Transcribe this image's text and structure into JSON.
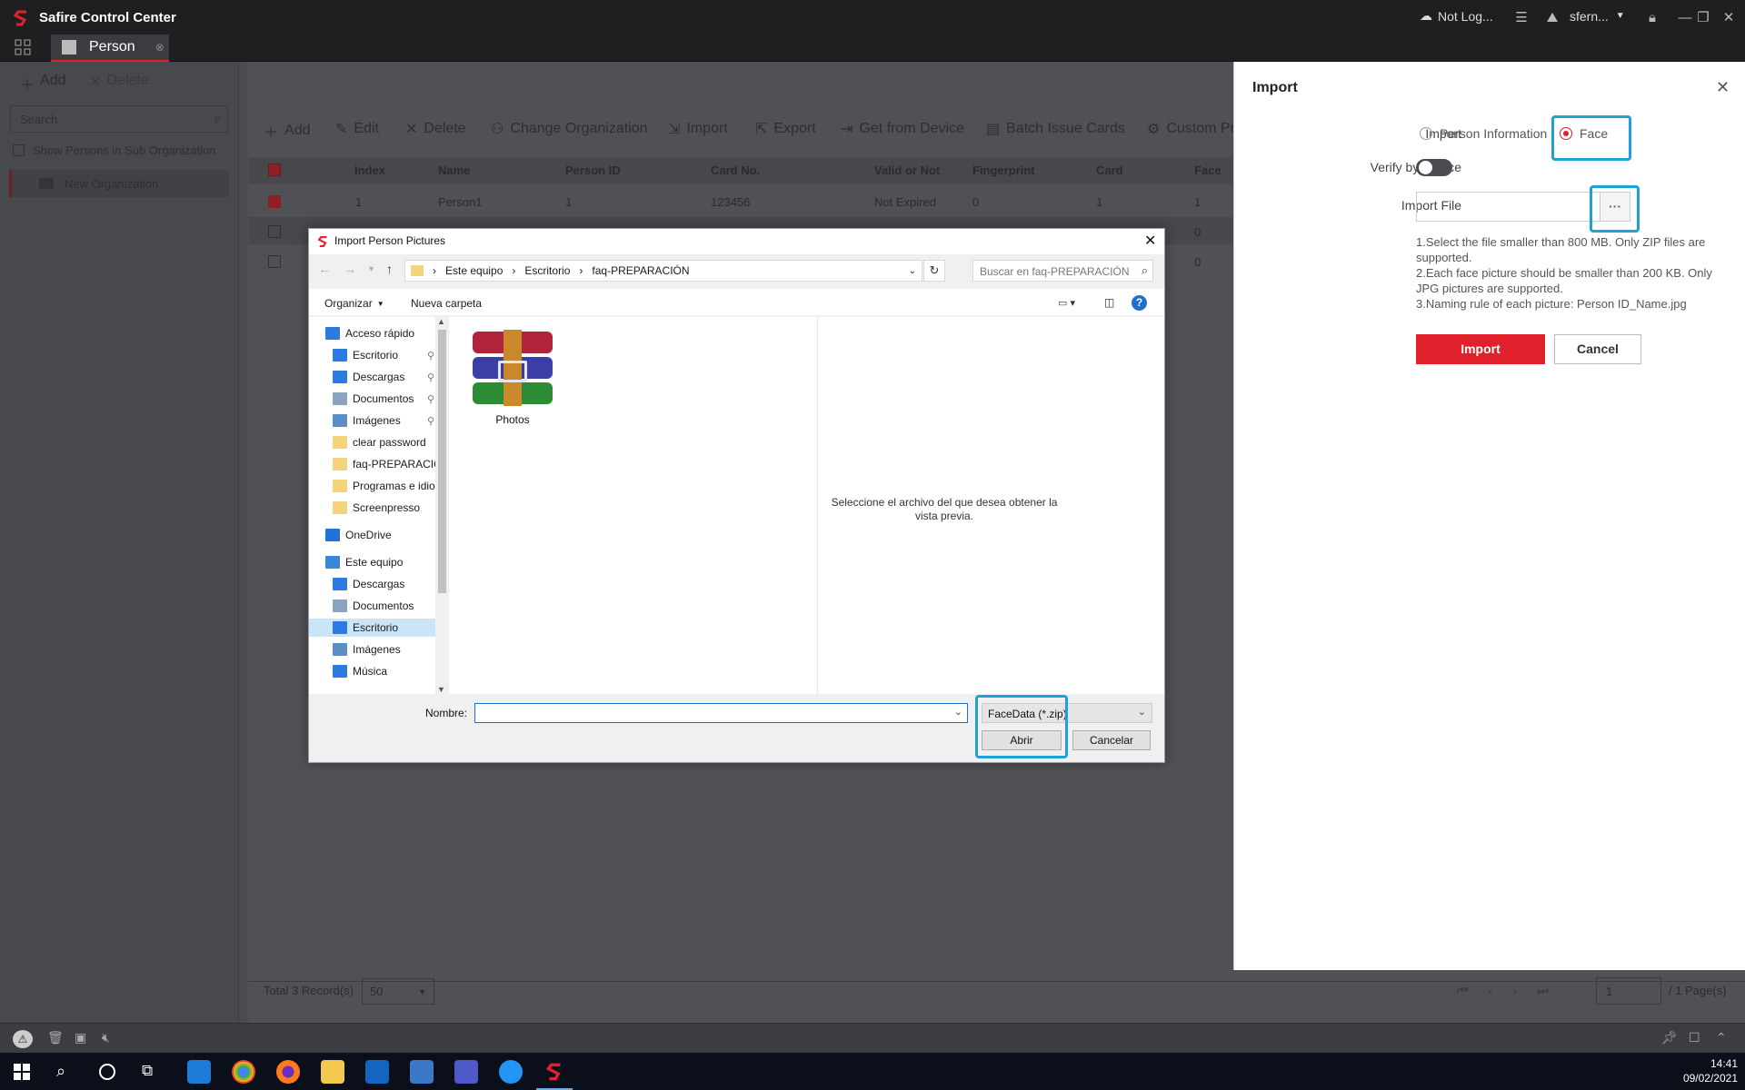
{
  "app": {
    "title": "Safire Control Center",
    "tab": "Person",
    "cloud_status": "Not Log...",
    "user": "sfern..."
  },
  "sidebar": {
    "add": "Add",
    "delete": "Delete",
    "search_placeholder": "Search",
    "show_sub": "Show Persons in Sub Organization",
    "org": "New Organization"
  },
  "toolbar": {
    "add": "Add",
    "edit": "Edit",
    "delete": "Delete",
    "change_org": "Change Organization",
    "import": "Import",
    "export": "Export",
    "get_from_device": "Get from Device",
    "batch_issue": "Batch Issue Cards",
    "custom": "Custom Pr"
  },
  "table": {
    "headers": [
      "Index",
      "Name",
      "Person ID",
      "Card No.",
      "Valid or Not",
      "Fingerprint",
      "Card",
      "Face"
    ],
    "rows": [
      {
        "index": "1",
        "name": "Person1",
        "person_id": "1",
        "card_no": "123456",
        "valid": "Not Expired",
        "fingerprint": "0",
        "card": "1",
        "face": "1"
      },
      {
        "face": "0"
      },
      {
        "face": "0"
      }
    ]
  },
  "footer": {
    "total": "Total 3 Record(s)",
    "page_size": "50",
    "page": "1",
    "pages": "/ 1 Page(s)"
  },
  "import_panel": {
    "title": "Import",
    "import_label": "Import",
    "opt_person": "Person Information",
    "opt_face": "Face",
    "verify_label": "Verify by Device",
    "file_label": "Import File",
    "browse": "···",
    "note1": "1.Select the file smaller than 800 MB. Only ZIP files are supported.",
    "note2": "2.Each face picture should be smaller than 200 KB. Only JPG pictures are supported.",
    "note3": "3.Naming rule of each picture: Person ID_Name.jpg",
    "import_btn": "Import",
    "cancel_btn": "Cancel",
    "accent": "#e0202b",
    "highlight": "#1ea0d9"
  },
  "dialog": {
    "title": "Import Person Pictures",
    "crumbs": [
      "Este equipo",
      "Escritorio",
      "faq-PREPARACIÓN"
    ],
    "search_placeholder": "Buscar en faq-PREPARACIÓN",
    "organize": "Organizar",
    "new_folder": "Nueva carpeta",
    "nav": [
      {
        "label": "Acceso rápido",
        "icon": "star-icon",
        "indent": 0
      },
      {
        "label": "Escritorio",
        "icon": "desktop-icon",
        "indent": 1,
        "pin": true
      },
      {
        "label": "Descargas",
        "icon": "download-icon",
        "indent": 1,
        "pin": true
      },
      {
        "label": "Documentos",
        "icon": "documents-icon",
        "indent": 1,
        "pin": true
      },
      {
        "label": "Imágenes",
        "icon": "images-icon",
        "indent": 1,
        "pin": true
      },
      {
        "label": "clear password",
        "icon": "folder-icon",
        "indent": 1
      },
      {
        "label": "faq-PREPARACIÓN",
        "icon": "folder-icon",
        "indent": 1
      },
      {
        "label": "Programas e idiomas",
        "icon": "folder-icon",
        "indent": 1
      },
      {
        "label": "Screenpresso",
        "icon": "folder-icon",
        "indent": 1
      },
      {
        "label": "OneDrive",
        "icon": "onedrive-icon",
        "indent": 0
      },
      {
        "label": "Este equipo",
        "icon": "computer-icon",
        "indent": 0
      },
      {
        "label": "Descargas",
        "icon": "download-icon",
        "indent": 1
      },
      {
        "label": "Documentos",
        "icon": "documents-icon",
        "indent": 1
      },
      {
        "label": "Escritorio",
        "icon": "desktop-icon",
        "indent": 1,
        "selected": true
      },
      {
        "label": "Imágenes",
        "icon": "images-icon",
        "indent": 1
      },
      {
        "label": "Música",
        "icon": "music-icon",
        "indent": 1
      }
    ],
    "file": "Photos",
    "preview": "Seleccione el archivo del que desea obtener la vista previa.",
    "name_label": "Nombre:",
    "filter": "FaceData (*.zip)",
    "open_btn": "Abrir",
    "cancel_btn": "Cancelar"
  },
  "taskbar": {
    "time": "14:41",
    "date": "09/02/2021"
  }
}
